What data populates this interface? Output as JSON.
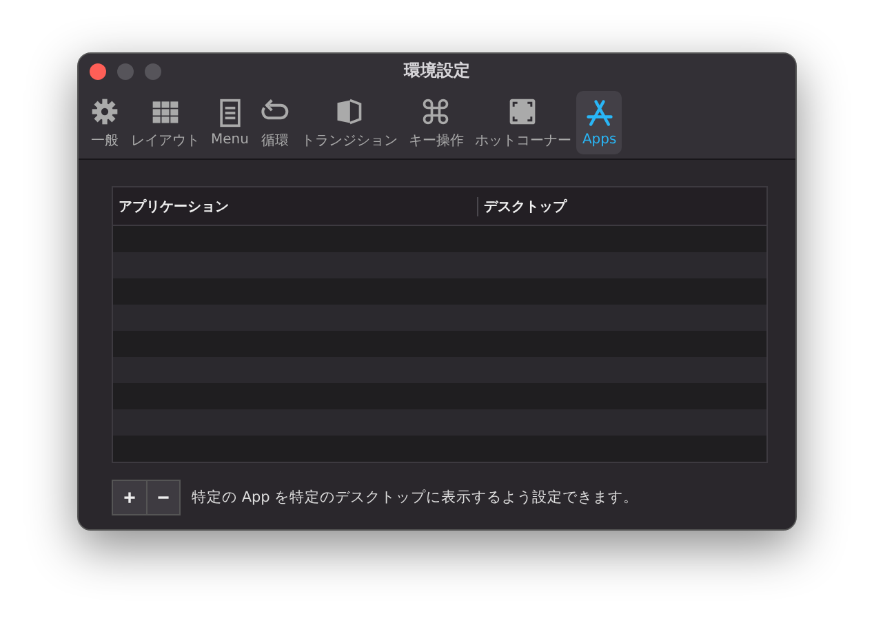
{
  "window": {
    "title": "環境設定"
  },
  "tabs": [
    {
      "label": "一般",
      "kind": "gear",
      "selected": false
    },
    {
      "label": "レイアウト",
      "kind": "grid",
      "selected": false
    },
    {
      "label": "Menu",
      "kind": "menu",
      "selected": false
    },
    {
      "label": "循環",
      "kind": "loop",
      "selected": false
    },
    {
      "label": "トランジション",
      "kind": "transition",
      "selected": false
    },
    {
      "label": "キー操作",
      "kind": "command",
      "selected": false
    },
    {
      "label": "ホットコーナー",
      "kind": "corners",
      "selected": false
    },
    {
      "label": "Apps",
      "kind": "apps",
      "selected": true
    }
  ],
  "table": {
    "columns": [
      "アプリケーション",
      "デスクトップ"
    ]
  },
  "buttons": [
    "+",
    "−"
  ],
  "hint": "特定の App を特定のデスクトップに表示するよう設定できます。"
}
